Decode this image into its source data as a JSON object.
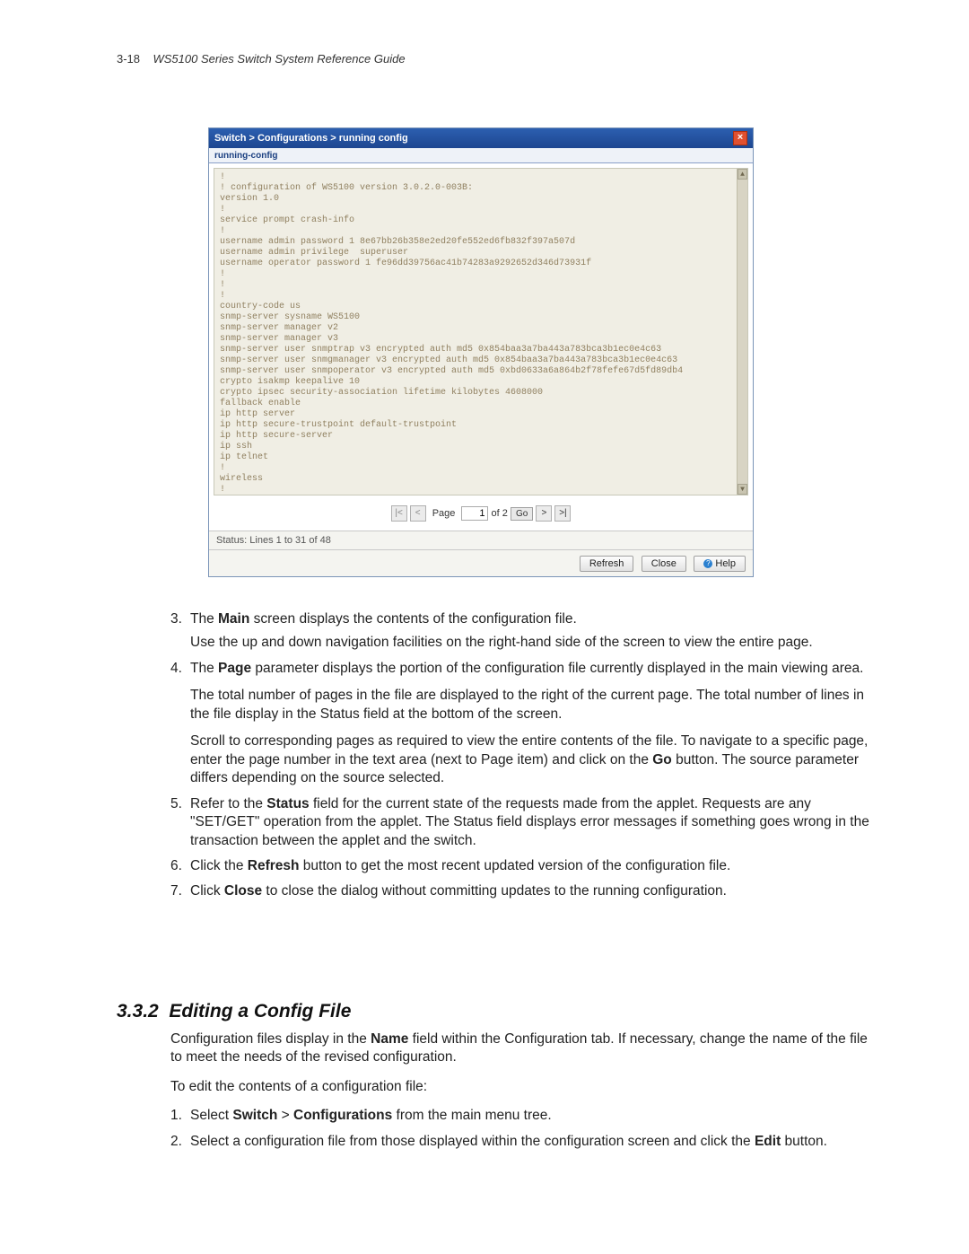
{
  "header": {
    "page_num": "3-18",
    "doc_title": "WS5100 Series Switch System Reference Guide"
  },
  "dialog": {
    "breadcrumb": "Switch > Configurations > running config",
    "subtitle": "running-config",
    "config_text": "!\n! configuration of WS5100 version 3.0.2.0-003B:\nversion 1.0\n!\nservice prompt crash-info\n!\nusername admin password 1 8e67bb26b358e2ed20fe552ed6fb832f397a507d\nusername admin privilege  superuser\nusername operator password 1 fe96dd39756ac41b74283a9292652d346d73931f\n!\n!\n!\ncountry-code us\nsnmp-server sysname WS5100\nsnmp-server manager v2\nsnmp-server manager v3\nsnmp-server user snmptrap v3 encrypted auth md5 0x854baa3a7ba443a783bca3b1ec0e4c63\nsnmp-server user snmgmanager v3 encrypted auth md5 0x854baa3a7ba443a783bca3b1ec0e4c63\nsnmp-server user snmpoperator v3 encrypted auth md5 0xbd0633a6a864b2f78fefe67d5fd89db4\ncrypto isakmp keepalive 10\ncrypto ipsec security-association lifetime kilobytes 4608000\nfallback enable\nip http server\nip http secure-trustpoint default-trustpoint\nip http secure-server\nip ssh\nip telnet\n!\nwireless\n!\nradius-server local",
    "pager": {
      "label": "Page",
      "current": "1",
      "of": "of 2",
      "go": "Go"
    },
    "status": "Status:   Lines 1 to 31 of 48",
    "buttons": {
      "refresh": "Refresh",
      "close": "Close",
      "help": "Help"
    }
  },
  "body": {
    "li3_a": "The ",
    "li3_b": "Main",
    "li3_c": " screen displays the contents of the configuration file.",
    "li3_p2": "Use the up and down navigation facilities on the right-hand side of the screen to view the entire page.",
    "li4_a": "The ",
    "li4_b": "Page",
    "li4_c": " parameter displays the portion of the configuration file currently displayed in the main viewing area.",
    "li4_p2": "The total number of pages in the file are displayed to the right of the current page. The total number of lines in the file display in the Status field at the bottom of the screen.",
    "li4_p3a": "Scroll to corresponding pages as required to view the entire contents of the file. To navigate to a specific page, enter the page number in the text area (next to Page item) and click on the ",
    "li4_p3b": "Go",
    "li4_p3c": " button. The source parameter differs depending on the source selected.",
    "li5_a": "Refer to the ",
    "li5_b": "Status",
    "li5_c": " field for the current state of the requests made from the applet. Requests are any \"SET/GET\" operation from the applet. The Status field displays error messages if something goes wrong in the transaction between the applet and the switch.",
    "li6_a": "Click the ",
    "li6_b": "Refresh",
    "li6_c": " button to get the most recent updated version of the configuration file.",
    "li7_a": "Click ",
    "li7_b": "Close",
    "li7_c": " to close the dialog without committing updates to the running configuration."
  },
  "section": {
    "num": "3.3.2",
    "title": "Editing a Config File",
    "p1_a": "Configuration files display in the ",
    "p1_b": "Name",
    "p1_c": " field within the Configuration tab. If necessary, change the name of the file to meet the needs of the revised configuration.",
    "p2": "To edit the contents of a configuration file:",
    "s1_a": "Select ",
    "s1_b": "Switch",
    "s1_c": " > ",
    "s1_d": "Configurations",
    "s1_e": " from the main menu tree.",
    "s2_a": "Select a configuration file from those displayed within the configuration screen and click the ",
    "s2_b": "Edit",
    "s2_c": " button."
  }
}
